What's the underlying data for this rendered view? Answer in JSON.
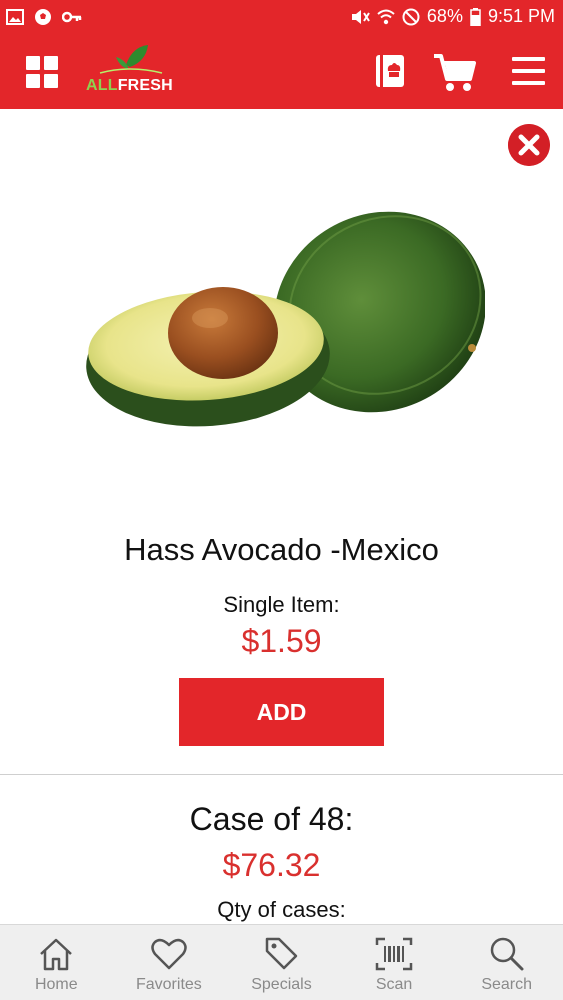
{
  "status_bar": {
    "battery": "68%",
    "time": "9:51 PM"
  },
  "header": {
    "logo_all": "ALL",
    "logo_fresh": "FRESH",
    "colors": {
      "brand_red": "#e3262a",
      "logo_green": "#8fd14f"
    }
  },
  "product": {
    "name": "Hass Avocado -Mexico",
    "single_label": "Single Item:",
    "single_price": "$1.59",
    "add_label": "ADD",
    "case_label": "Case of 48:",
    "case_price": "$76.32",
    "qty_label": "Qty of cases:",
    "price_color": "#d9302e"
  },
  "bottom_nav": [
    {
      "label": "Home",
      "icon": "home-icon"
    },
    {
      "label": "Favorites",
      "icon": "heart-icon"
    },
    {
      "label": "Specials",
      "icon": "tag-icon"
    },
    {
      "label": "Scan",
      "icon": "barcode-scan-icon"
    },
    {
      "label": "Search",
      "icon": "search-icon"
    }
  ]
}
